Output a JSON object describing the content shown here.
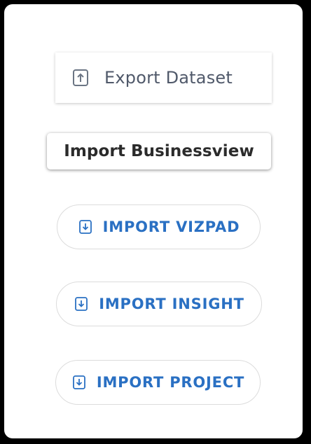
{
  "buttons": {
    "export_dataset": {
      "label": "Export Dataset",
      "icon": "upload-icon"
    },
    "import_businessview": {
      "label": "Import Businessview"
    },
    "import_vizpad": {
      "label": "IMPORT VIZPAD",
      "icon": "download-icon"
    },
    "import_insight": {
      "label": "IMPORT INSIGHT",
      "icon": "download-icon"
    },
    "import_project": {
      "label": "IMPORT PROJECT",
      "icon": "download-icon"
    }
  },
  "colors": {
    "accent": "#2a70c3",
    "export_text": "#50596a",
    "dark_text": "#2b2b2b"
  }
}
